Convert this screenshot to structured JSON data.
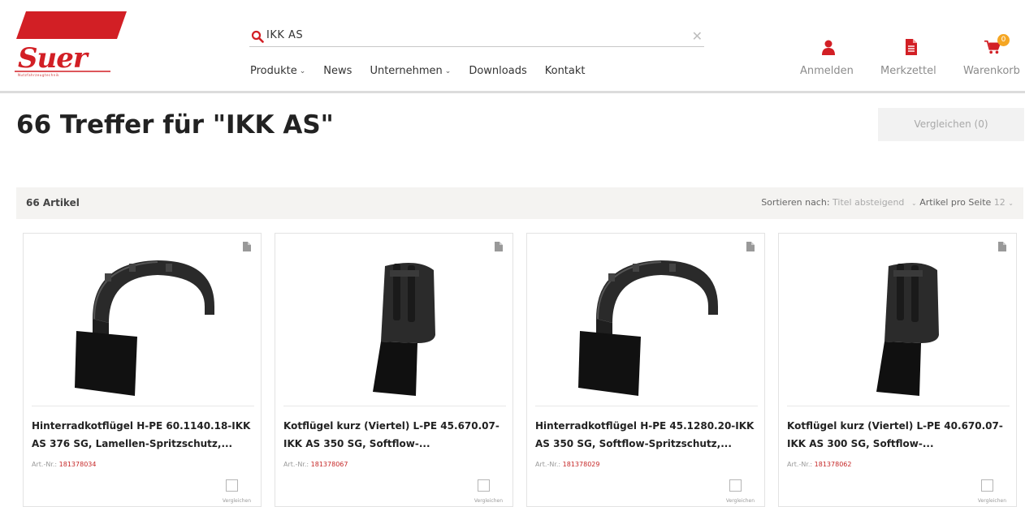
{
  "brand": {
    "name": "Suer",
    "tagline": "Nutzfahrzeugtechnik",
    "color": "#d21f25"
  },
  "search": {
    "value": "IKK AS",
    "clear_icon": "close-icon",
    "icon": "search-icon"
  },
  "nav": [
    {
      "label": "Produkte",
      "has_dropdown": true
    },
    {
      "label": "News",
      "has_dropdown": false
    },
    {
      "label": "Unternehmen",
      "has_dropdown": true
    },
    {
      "label": "Downloads",
      "has_dropdown": false
    },
    {
      "label": "Kontakt",
      "has_dropdown": false
    }
  ],
  "user_menu": {
    "login": {
      "label": "Anmelden",
      "icon": "user-icon"
    },
    "wishlist": {
      "label": "Merkzettel",
      "icon": "document-icon"
    },
    "cart": {
      "label": "Warenkorb",
      "icon": "cart-icon",
      "badge": "0"
    }
  },
  "page": {
    "title": "66 Treffer für \"IKK AS\"",
    "compare_button": "Vergleichen (0)"
  },
  "toolbar": {
    "count": "66 Artikel",
    "sort_label": "Sortieren nach:",
    "sort_value": "Titel absteigend",
    "per_page_label": "Artikel pro Seite",
    "per_page_value": "12"
  },
  "products": [
    {
      "title": "Hinterradkotflügel H-PE 60.1140.18-IKK AS 376 SG, Lamellen-Spritzschutz,...",
      "art_label": "Art.-Nr.:",
      "art_nr": "181378034",
      "compare_label": "Vergleichen",
      "shape": "full"
    },
    {
      "title": "Kotflügel kurz (Viertel) L-PE 45.670.07-IKK AS 350 SG, Softflow-...",
      "art_label": "Art.-Nr.:",
      "art_nr": "181378067",
      "compare_label": "Vergleichen",
      "shape": "quarter"
    },
    {
      "title": "Hinterradkotflügel H-PE 45.1280.20-IKK AS 350 SG, Softflow-Spritzschutz,...",
      "art_label": "Art.-Nr.:",
      "art_nr": "181378029",
      "compare_label": "Vergleichen",
      "shape": "full"
    },
    {
      "title": "Kotflügel kurz (Viertel) L-PE 40.670.07-IKK AS 300 SG, Softflow-...",
      "art_label": "Art.-Nr.:",
      "art_nr": "181378062",
      "compare_label": "Vergleichen",
      "shape": "quarter"
    }
  ]
}
